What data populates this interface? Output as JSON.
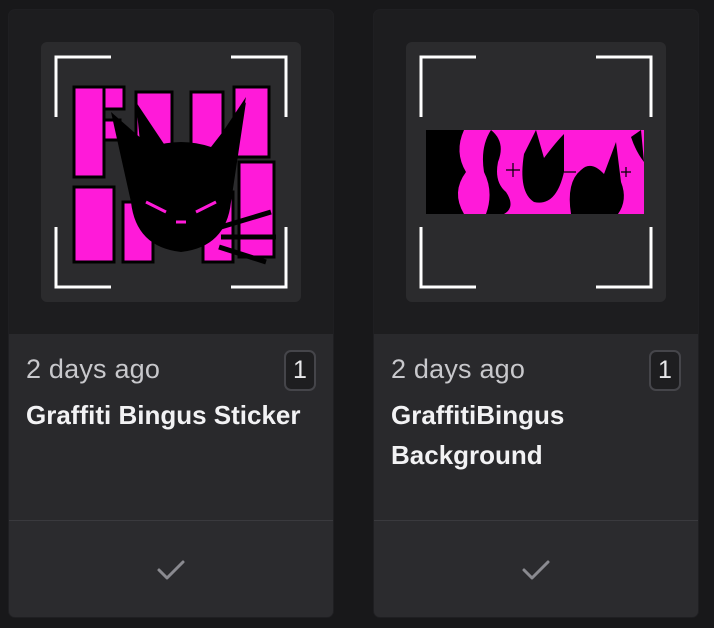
{
  "cards": [
    {
      "date": "2 days ago",
      "count": "1",
      "title": "Graffiti Bingus Sticker",
      "thumbnail_icon": "graffiti-cat-sticker",
      "action_icon": "checkmark-icon"
    },
    {
      "date": "2 days ago",
      "count": "1",
      "title": "GraffitiBingus Background",
      "thumbnail_icon": "graffiti-cat-background",
      "action_icon": "checkmark-icon"
    }
  ],
  "colors": {
    "page_background": "#18181a",
    "card_background": "#29292c",
    "accent_magenta": "#ff1ad9",
    "frame_corners": "#ffffff"
  }
}
